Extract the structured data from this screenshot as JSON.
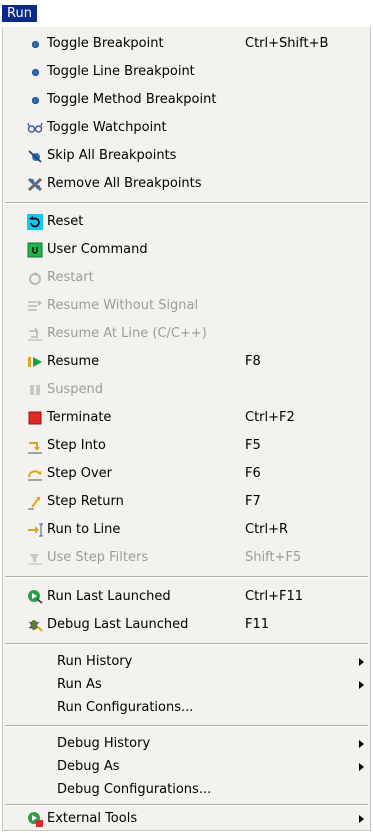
{
  "menubar": {
    "title": "Run"
  },
  "items": [
    {
      "label": "Toggle Breakpoint",
      "shortcut": "Ctrl+Shift+B",
      "icon": "dot-icon"
    },
    {
      "label": "Toggle Line Breakpoint",
      "shortcut": "",
      "icon": "dot-icon"
    },
    {
      "label": "Toggle Method Breakpoint",
      "shortcut": "",
      "icon": "dot-icon"
    },
    {
      "label": "Toggle Watchpoint",
      "shortcut": "",
      "icon": "glasses-icon"
    },
    {
      "label": "Skip All Breakpoints",
      "shortcut": "",
      "icon": "skip-breakpoints-icon"
    },
    {
      "label": "Remove All Breakpoints",
      "shortcut": "",
      "icon": "remove-breakpoints-icon"
    },
    {
      "label": "Reset",
      "shortcut": "",
      "icon": "reset-icon"
    },
    {
      "label": "User Command",
      "shortcut": "",
      "icon": "user-command-icon"
    },
    {
      "label": "Restart",
      "shortcut": "",
      "icon": "restart-icon"
    },
    {
      "label": "Resume Without Signal",
      "shortcut": "",
      "icon": "resume-without-signal-icon"
    },
    {
      "label": "Resume At Line (C/C++)",
      "shortcut": "",
      "icon": "resume-at-line-icon"
    },
    {
      "label": "Resume",
      "shortcut": "F8",
      "icon": "resume-icon"
    },
    {
      "label": "Suspend",
      "shortcut": "",
      "icon": "suspend-icon"
    },
    {
      "label": "Terminate",
      "shortcut": "Ctrl+F2",
      "icon": "terminate-icon"
    },
    {
      "label": "Step Into",
      "shortcut": "F5",
      "icon": "step-into-icon"
    },
    {
      "label": "Step Over",
      "shortcut": "F6",
      "icon": "step-over-icon"
    },
    {
      "label": "Step Return",
      "shortcut": "F7",
      "icon": "step-return-icon"
    },
    {
      "label": "Run to Line",
      "shortcut": "Ctrl+R",
      "icon": "run-to-line-icon"
    },
    {
      "label": "Use Step Filters",
      "shortcut": "Shift+F5",
      "icon": "step-filters-icon"
    },
    {
      "label": "Run Last Launched",
      "shortcut": "Ctrl+F11",
      "icon": "run-icon"
    },
    {
      "label": "Debug Last Launched",
      "shortcut": "F11",
      "icon": "debug-icon"
    },
    {
      "label": "Run History",
      "shortcut": "",
      "icon": ""
    },
    {
      "label": "Run As",
      "shortcut": "",
      "icon": ""
    },
    {
      "label": "Run Configurations...",
      "shortcut": "",
      "icon": ""
    },
    {
      "label": "Debug History",
      "shortcut": "",
      "icon": ""
    },
    {
      "label": "Debug As",
      "shortcut": "",
      "icon": ""
    },
    {
      "label": "Debug Configurations...",
      "shortcut": "",
      "icon": ""
    },
    {
      "label": "External Tools",
      "shortcut": "",
      "icon": "external-tools-icon"
    }
  ],
  "colors": {
    "menubar_selected": "#0a2a8a",
    "menu_bg": "#f3f2ee",
    "disabled_text": "#9b9b98"
  }
}
